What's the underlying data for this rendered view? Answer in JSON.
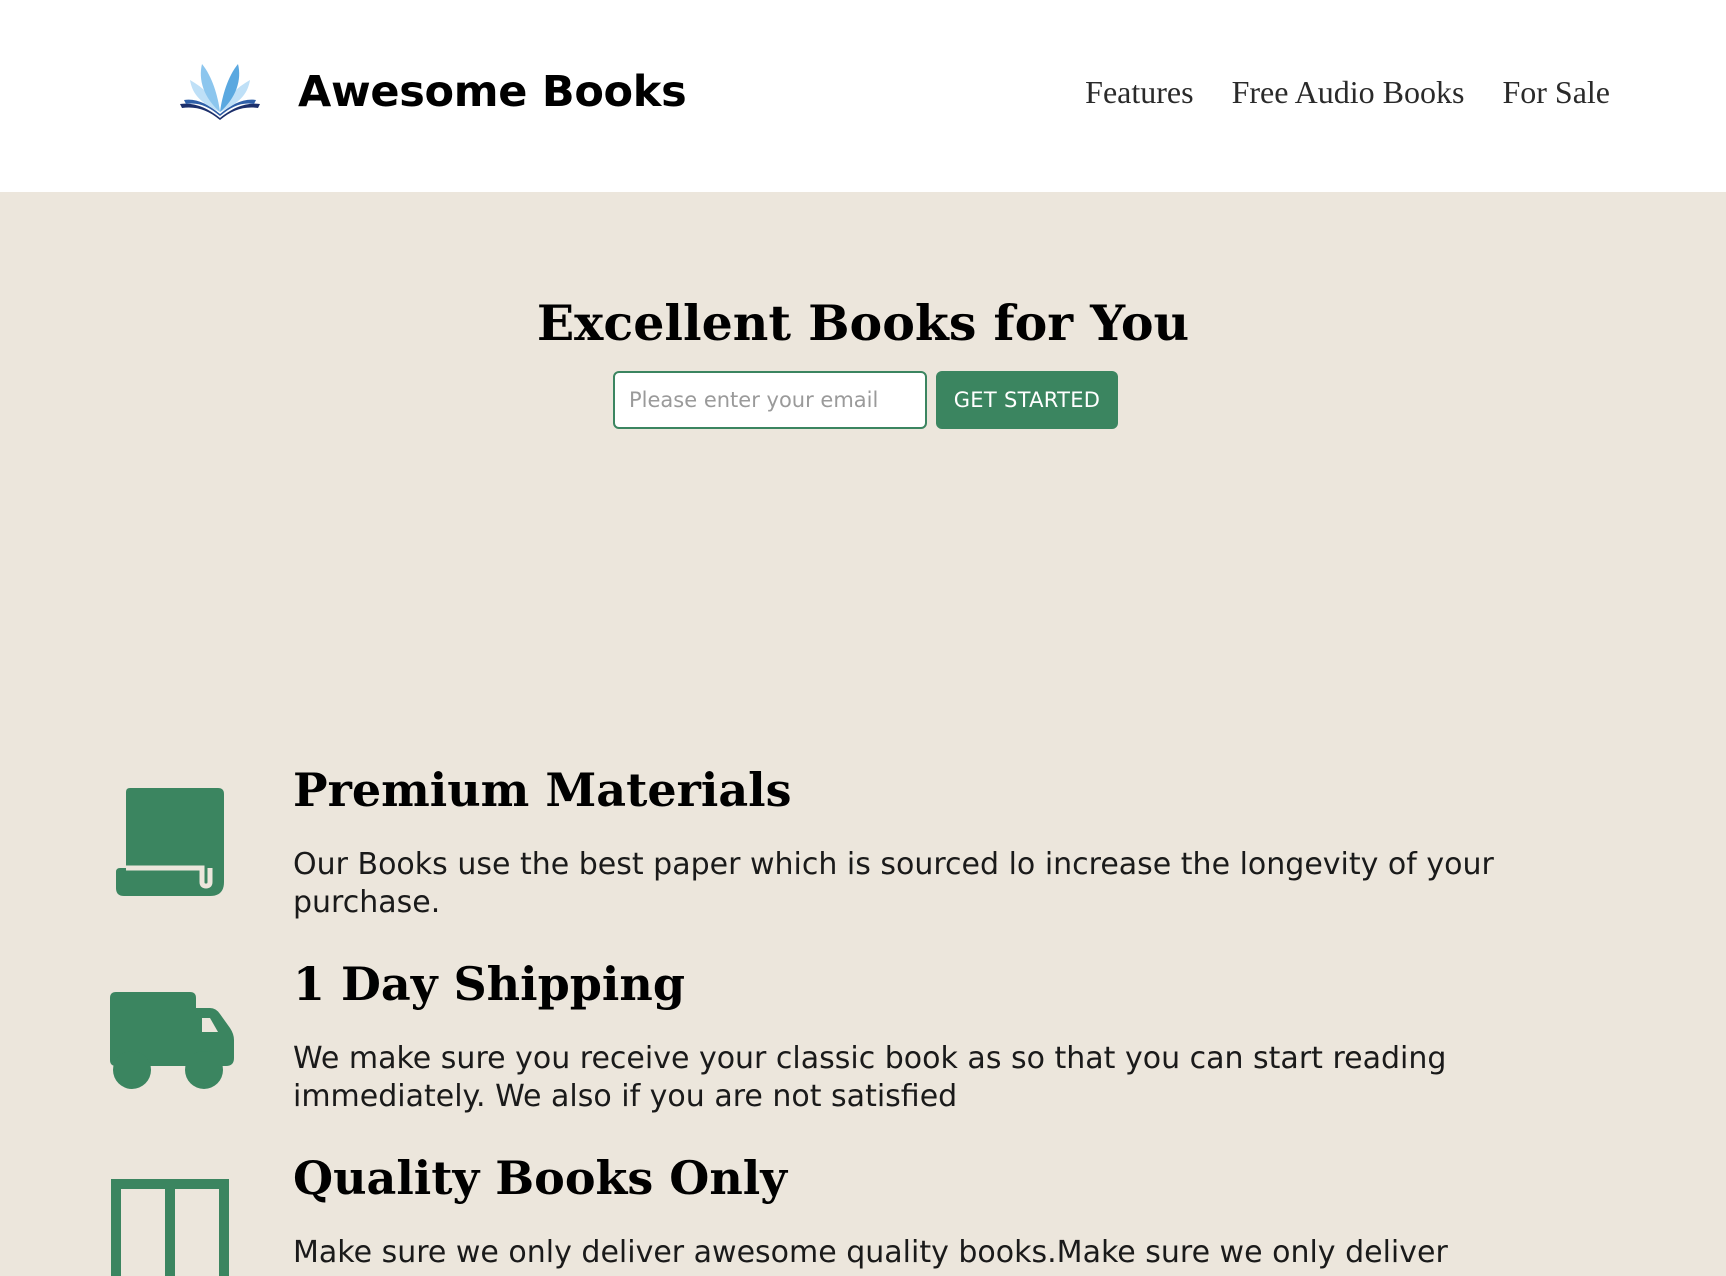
{
  "header": {
    "brand": "Awesome Books",
    "logo_icon": "open-book-icon",
    "nav": [
      {
        "label": "Features"
      },
      {
        "label": "Free Audio Books"
      },
      {
        "label": "For Sale"
      }
    ]
  },
  "hero": {
    "title": "Excellent Books for You",
    "email_placeholder": "Please enter your email",
    "email_value": "",
    "cta_label": "GET STARTED"
  },
  "features": [
    {
      "icon": "scroll-icon",
      "title": "Premium Materials",
      "text": "Our Books use the best paper which is sourced lo increase the longevity of your purchase."
    },
    {
      "icon": "truck-icon",
      "title": "1 Day Shipping",
      "text": "We make sure you receive your classic book as so that you can start reading immediately. We also if you are not satisfied"
    },
    {
      "icon": "book-icon",
      "title": "Quality Books Only",
      "text": "Make sure we only deliver awesome quality books.Make sure we only deliver"
    }
  ],
  "colors": {
    "accent": "#3b8560",
    "background": "#ece6dc",
    "header_background": "#ffffff"
  }
}
